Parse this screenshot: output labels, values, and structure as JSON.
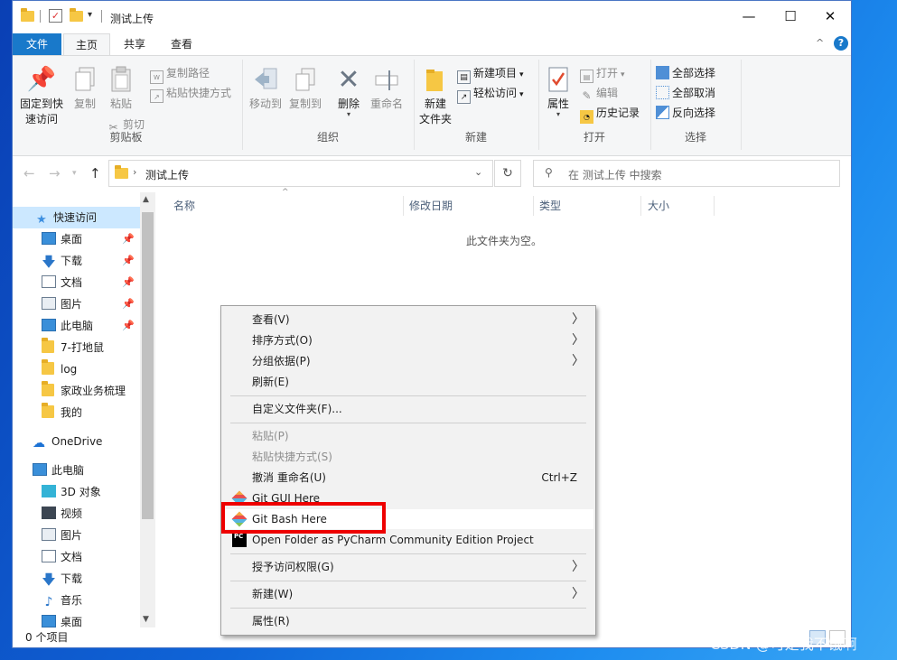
{
  "window": {
    "title": "测试上传",
    "controls": {
      "minimize": "—",
      "maximize": "☐",
      "close": "✕"
    }
  },
  "ribbon": {
    "tabs": [
      "文件",
      "主页",
      "共享",
      "查看"
    ],
    "groups": {
      "clipboard": {
        "label": "剪贴板",
        "pin": "固定到快\n速访问",
        "pin_l1": "固定到快",
        "pin_l2": "速访问",
        "copy": "复制",
        "paste": "粘贴",
        "copy_path": "复制路径",
        "paste_shortcut": "粘贴快捷方式",
        "cut": "剪切"
      },
      "organize": {
        "label": "组织",
        "move_to": "移动到",
        "copy_to": "复制到",
        "delete": "删除",
        "rename": "重命名"
      },
      "new": {
        "label": "新建",
        "new_folder_l1": "新建",
        "new_folder_l2": "文件夹",
        "new_item": "新建项目",
        "easy_access": "轻松访问"
      },
      "open": {
        "label": "打开",
        "properties": "属性",
        "open": "打开",
        "edit": "编辑",
        "history": "历史记录"
      },
      "select": {
        "label": "选择",
        "select_all": "全部选择",
        "select_none": "全部取消",
        "invert": "反向选择"
      }
    }
  },
  "address": {
    "path": "测试上传",
    "search_placeholder": "在 测试上传 中搜索"
  },
  "nav": {
    "quick_access": "快速访问",
    "items": [
      {
        "label": "桌面",
        "pinned": true
      },
      {
        "label": "下载",
        "pinned": true
      },
      {
        "label": "文档",
        "pinned": true
      },
      {
        "label": "图片",
        "pinned": true
      },
      {
        "label": "此电脑",
        "pinned": true
      },
      {
        "label": "7-打地鼠",
        "pinned": false
      },
      {
        "label": "log",
        "pinned": false
      },
      {
        "label": "家政业务梳理",
        "pinned": false
      },
      {
        "label": "我的",
        "pinned": false
      }
    ],
    "onedrive": "OneDrive",
    "this_pc": "此电脑",
    "pc_items": [
      "3D 对象",
      "视频",
      "图片",
      "文档",
      "下载",
      "音乐",
      "桌面"
    ]
  },
  "content": {
    "columns": [
      "名称",
      "修改日期",
      "类型",
      "大小"
    ],
    "empty_text": "此文件夹为空。"
  },
  "status": {
    "items": "0 个项目"
  },
  "context_menu": {
    "items": [
      {
        "label": "查看(V)",
        "submenu": true
      },
      {
        "label": "排序方式(O)",
        "submenu": true
      },
      {
        "label": "分组依据(P)",
        "submenu": true
      },
      {
        "label": "刷新(E)"
      },
      {
        "label": "自定义文件夹(F)..."
      },
      {
        "label": "粘贴(P)",
        "disabled": true
      },
      {
        "label": "粘贴快捷方式(S)",
        "disabled": true
      },
      {
        "label": "撤消 重命名(U)",
        "shortcut": "Ctrl+Z"
      },
      {
        "label": "Git GUI Here"
      },
      {
        "label": "Git Bash Here",
        "highlighted": true
      },
      {
        "label": "Open Folder as PyCharm Community Edition Project"
      },
      {
        "label": "授予访问权限(G)",
        "submenu": true
      },
      {
        "label": "新建(W)",
        "submenu": true
      },
      {
        "label": "属性(R)"
      }
    ]
  },
  "watermark": "CSDN @可是我不饿啊",
  "colors": {
    "accent": "#1979ca",
    "highlight_box": "#ee0000",
    "folder": "#f6c744"
  }
}
